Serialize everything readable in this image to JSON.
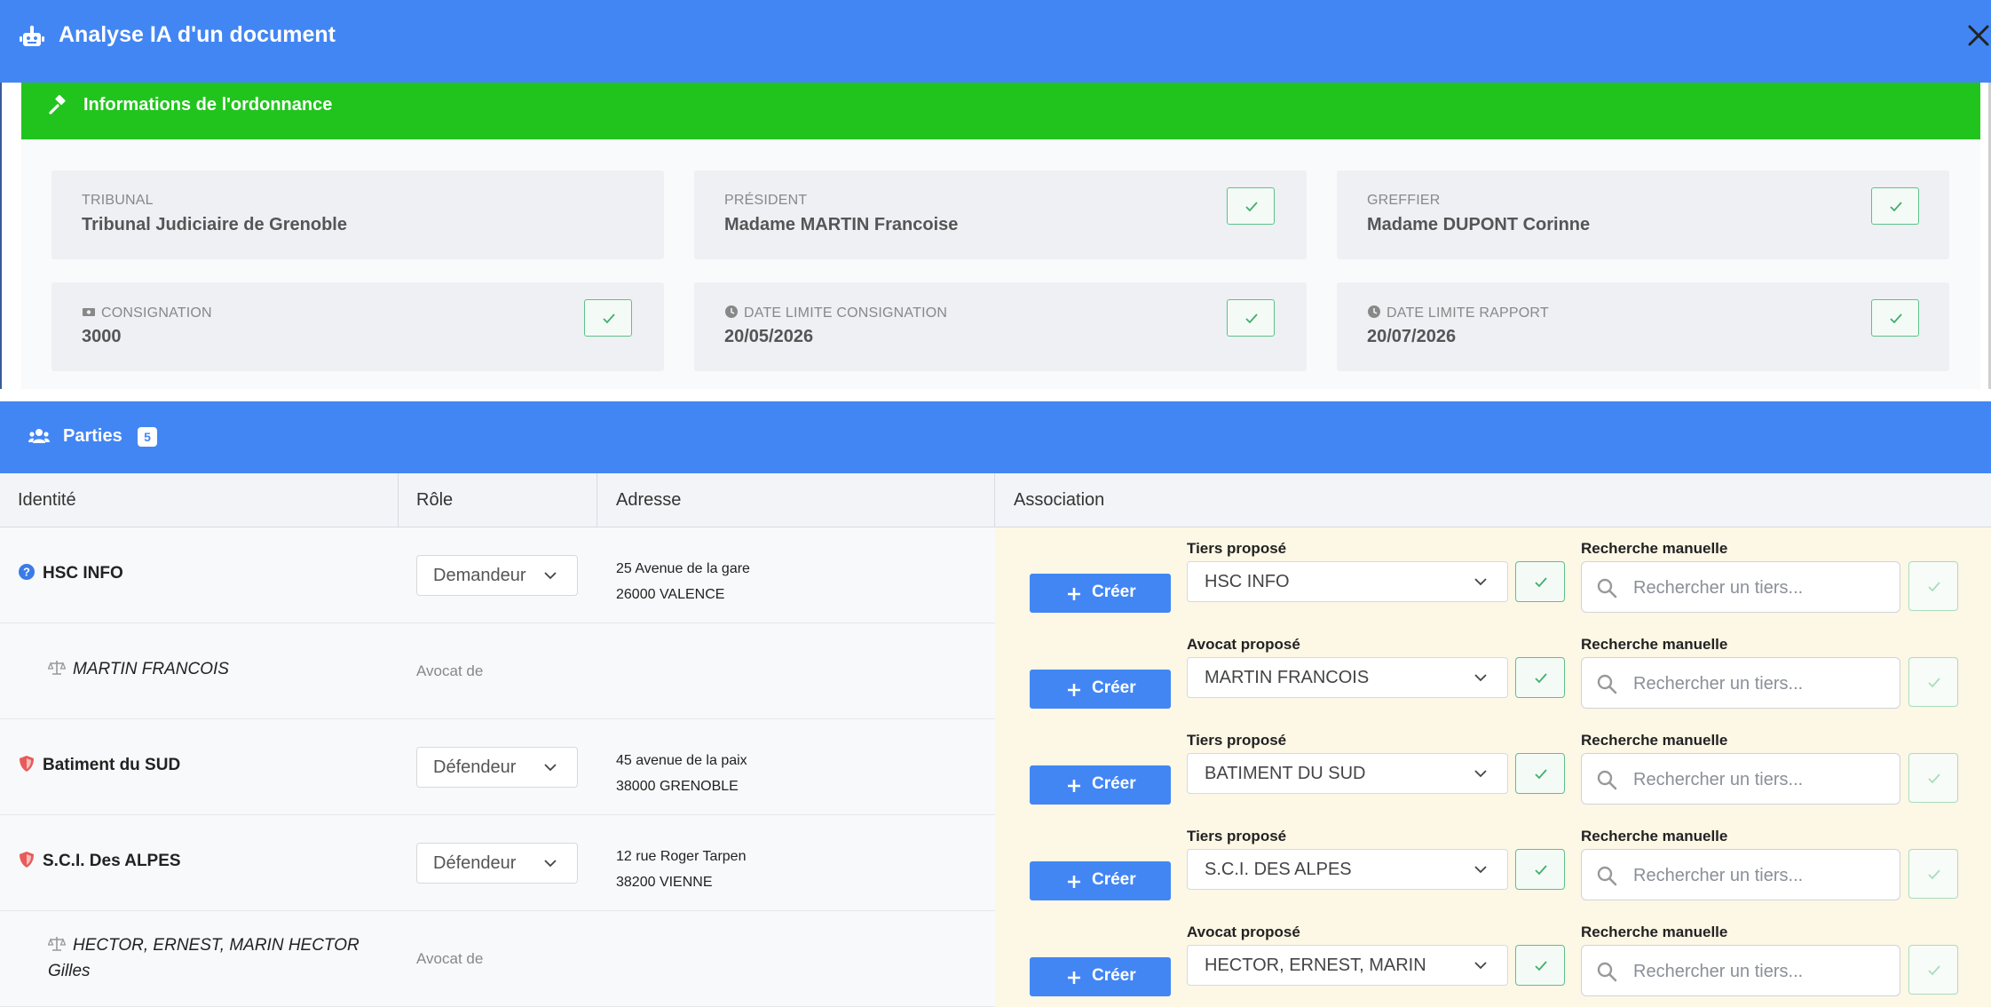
{
  "modal": {
    "title": "Analyse IA d'un document",
    "icon": "robot-icon",
    "close_icon": "close-icon"
  },
  "ordonnance": {
    "title": "Informations de l'ordonnance",
    "accent": "#21c41d",
    "fields": [
      {
        "label": "TRIBUNAL",
        "value": "Tribunal Judiciaire de Grenoble",
        "icon": "",
        "has_check": false
      },
      {
        "label": "PRÉSIDENT",
        "value": "Madame MARTIN Francoise",
        "icon": "",
        "has_check": true
      },
      {
        "label": "GREFFIER",
        "value": "Madame DUPONT Corinne",
        "icon": "",
        "has_check": true
      },
      {
        "label": "CONSIGNATION",
        "value": "3000",
        "icon": "money-icon",
        "has_check": true
      },
      {
        "label": "DATE LIMITE CONSIGNATION",
        "value": "20/05/2026",
        "icon": "clock-icon",
        "has_check": true
      },
      {
        "label": "DATE LIMITE RAPPORT",
        "value": "20/07/2026",
        "icon": "clock-icon",
        "has_check": true
      }
    ]
  },
  "parties": {
    "title": "Parties",
    "count": "5",
    "accent": "#4286f4",
    "columns": {
      "identite": "Identité",
      "role": "Rôle",
      "adresse": "Adresse",
      "association": "Association"
    },
    "create_label": "Créer",
    "search_label": "Recherche manuelle",
    "search_placeholder": "Rechercher un tiers...",
    "rows": [
      {
        "name": "HSC INFO",
        "icon": "question-circle-icon",
        "is_lawyer": false,
        "role": "Demandeur",
        "role_text": "",
        "address_line1": "25 Avenue de la gare",
        "address_line2": "26000 VALENCE",
        "proposal_label": "Tiers proposé",
        "proposal_value": "HSC INFO"
      },
      {
        "name": "MARTIN FRANCOIS",
        "icon": "scale-icon",
        "is_lawyer": true,
        "role": "",
        "role_text": "Avocat de",
        "address_line1": "",
        "address_line2": "",
        "proposal_label": "Avocat proposé",
        "proposal_value": "MARTIN FRANCOIS"
      },
      {
        "name": "Batiment du SUD",
        "icon": "shield-icon",
        "is_lawyer": false,
        "role": "Défendeur",
        "role_text": "",
        "address_line1": "45 avenue de la paix",
        "address_line2": "38000 GRENOBLE",
        "proposal_label": "Tiers proposé",
        "proposal_value": "BATIMENT DU SUD"
      },
      {
        "name": "S.C.I. Des ALPES",
        "icon": "shield-icon",
        "is_lawyer": false,
        "role": "Défendeur",
        "role_text": "",
        "address_line1": "12 rue Roger Tarpen",
        "address_line2": "38200 VIENNE",
        "proposal_label": "Tiers proposé",
        "proposal_value": "S.C.I. DES ALPES"
      },
      {
        "name": "HECTOR, ERNEST, MARIN HECTOR",
        "name_line2": "Gilles",
        "icon": "scale-icon",
        "is_lawyer": true,
        "role": "",
        "role_text": "Avocat de",
        "address_line1": "",
        "address_line2": "",
        "proposal_label": "Avocat proposé",
        "proposal_value": "HECTOR, ERNEST, MARIN"
      }
    ]
  }
}
